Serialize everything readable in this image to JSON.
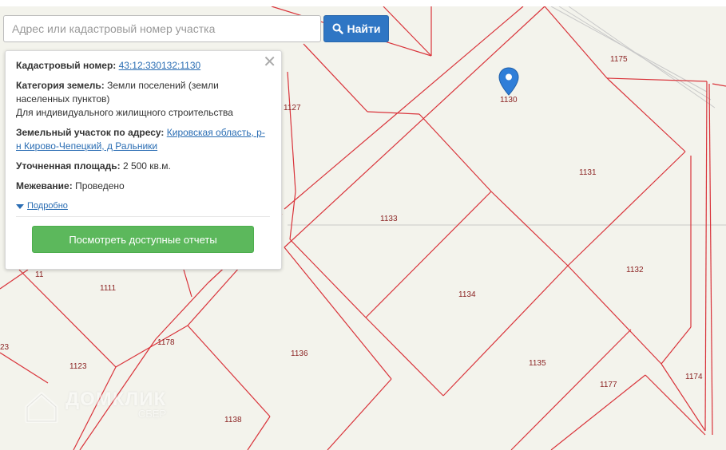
{
  "search": {
    "placeholder": "Адрес или кадастровый номер участка",
    "button_label": "Найти",
    "button_icon": "search-icon"
  },
  "popup": {
    "cadastral_label": "Кадастровый номер:",
    "cadastral_value": "43:12:330132:1130",
    "category_label": "Категория земель:",
    "category_value": "Земли поселений (земли населенных пунктов)",
    "category_use": "Для индивидуального жилищного строительства",
    "address_label": "Земельный участок по адресу:",
    "address_value": "Кировская область, р-н Кирово-Чепецкий, д Ральники",
    "area_label": "Уточненная площадь:",
    "area_value": "2 500 кв.м.",
    "survey_label": "Межевание:",
    "survey_value": "Проведено",
    "more_label": "Подробно",
    "reports_button": "Посмотреть доступные отчеты"
  },
  "map": {
    "plot_color": "#d9333a",
    "pin_color": "#2f7ed8",
    "plot_numbers": [
      "1130",
      "1175",
      "1127",
      "1131",
      "1133",
      "1132",
      "1134",
      "1111",
      "1178",
      "1136",
      "1123",
      "1135",
      "1177",
      "1174",
      "1138",
      "11",
      "23"
    ]
  },
  "watermark": {
    "brand": "ДОМКЛИК",
    "sub": "СБЕР"
  }
}
